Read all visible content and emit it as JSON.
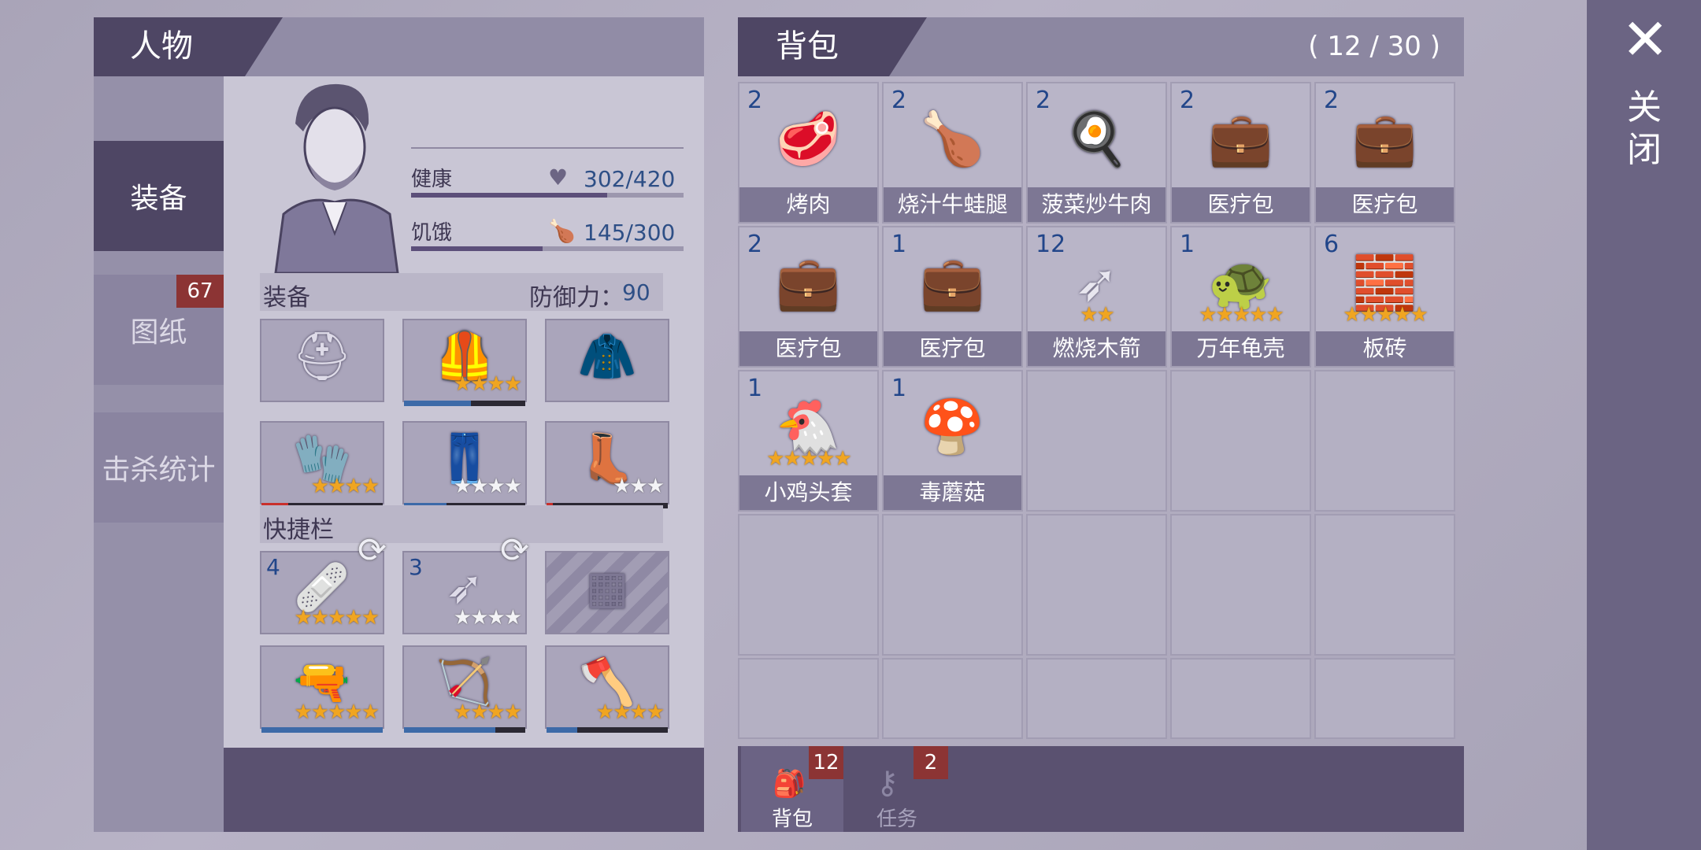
{
  "character": {
    "title": "人物",
    "tabs": [
      {
        "label": "装备",
        "active": true
      },
      {
        "label": "图纸",
        "badge": "67"
      },
      {
        "label": "击杀统计"
      }
    ],
    "health": {
      "label": "健康",
      "value": "302/420",
      "fraction": 0.719
    },
    "hunger": {
      "label": "饥饿",
      "value": "145/300",
      "fraction": 0.483
    },
    "equipment": {
      "label": "装备",
      "defense_label": "防御力：",
      "defense_value": "90",
      "slots": [
        {
          "icon": "helmet-icon",
          "stars": 0,
          "bar": 0
        },
        {
          "icon": "armor-vest-icon",
          "stars": 4,
          "bar": 0.55
        },
        {
          "icon": "jacket-icon",
          "stars": 0,
          "bar": 0
        },
        {
          "icon": "gloves-icon",
          "stars": 4,
          "bar": 0.22,
          "bar_color": "#c9302c"
        },
        {
          "icon": "pants-icon",
          "stars": 4,
          "gold": 0,
          "bar": 0.35
        },
        {
          "icon": "boots-icon",
          "stars": 3,
          "gold": 0,
          "bar": 0.05,
          "bar_color": "#c9302c"
        }
      ]
    },
    "quickbar": {
      "label": "快捷栏",
      "slots": [
        {
          "icon": "bandage-icon",
          "count": "4",
          "stars": 5,
          "gold": 5
        },
        {
          "icon": "fire-arrow-icon",
          "count": "3",
          "stars": 4,
          "gold": 0
        },
        {
          "icon": "locked-slot-icon",
          "count": "",
          "stars": 0,
          "gold": 0
        },
        {
          "icon": "shotgun-icon",
          "count": "",
          "stars": 5,
          "gold": 5,
          "bar": 1.0
        },
        {
          "icon": "bow-icon",
          "count": "",
          "stars": 4,
          "gold": 4,
          "bar": 0.75
        },
        {
          "icon": "axe-icon",
          "count": "",
          "stars": 4,
          "gold": 4,
          "bar": 0.25
        }
      ]
    }
  },
  "bag": {
    "title": "背包",
    "capacity": "( 12 / 30 )",
    "items": [
      {
        "name": "烤肉",
        "count": "2",
        "icon": "steak-icon",
        "stars": 0
      },
      {
        "name": "烧汁牛蛙腿",
        "count": "2",
        "icon": "frog-legs-icon",
        "stars": 0
      },
      {
        "name": "菠菜炒牛肉",
        "count": "2",
        "icon": "stirfry-pan-icon",
        "stars": 0
      },
      {
        "name": "医疗包",
        "count": "2",
        "icon": "medkit-icon",
        "stars": 0
      },
      {
        "name": "医疗包",
        "count": "2",
        "icon": "medkit-icon",
        "stars": 0
      },
      {
        "name": "医疗包",
        "count": "2",
        "icon": "medkit-icon",
        "stars": 0
      },
      {
        "name": "医疗包",
        "count": "1",
        "icon": "medkit-icon",
        "stars": 0
      },
      {
        "name": "燃烧木箭",
        "count": "12",
        "icon": "fire-arrow-icon",
        "stars": 2
      },
      {
        "name": "万年龟壳",
        "count": "1",
        "icon": "turtle-shell-icon",
        "stars": 5
      },
      {
        "name": "板砖",
        "count": "6",
        "icon": "brick-icon",
        "stars": 5
      },
      {
        "name": "小鸡头套",
        "count": "1",
        "icon": "chicken-mask-icon",
        "stars": 5
      },
      {
        "name": "毒蘑菇",
        "count": "1",
        "icon": "mushroom-icon",
        "stars": 0
      }
    ],
    "tabs": [
      {
        "label": "背包",
        "badge": "12",
        "active": true
      },
      {
        "label": "任务",
        "badge": "2"
      }
    ]
  },
  "close": {
    "label": "关闭"
  }
}
